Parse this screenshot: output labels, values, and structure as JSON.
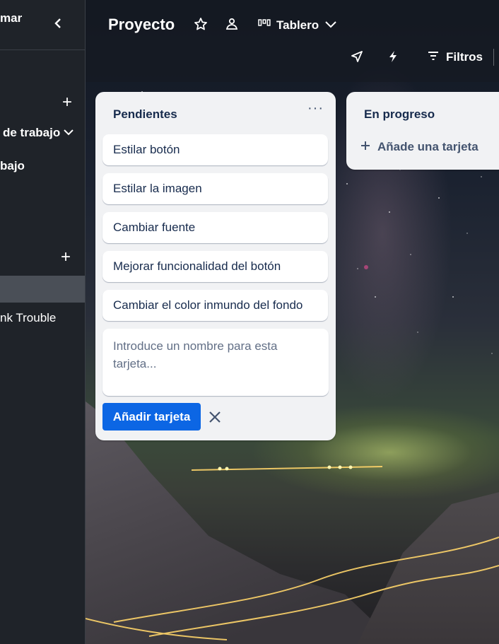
{
  "sidebar": {
    "top_text": "mar",
    "items": [
      {
        "label": "de trabajo"
      },
      {
        "label": "bajo"
      },
      {
        "label": "nk Trouble"
      }
    ]
  },
  "header": {
    "board_title": "Proyecto",
    "view_label": "Tablero",
    "filters_label": "Filtros"
  },
  "lists": [
    {
      "title": "Pendientes",
      "cards": [
        {
          "label": "Estilar botón"
        },
        {
          "label": "Estilar la imagen"
        },
        {
          "label": "Cambiar fuente"
        },
        {
          "label": "Mejorar funcionalidad del botón"
        },
        {
          "label": "Cambiar el color inmundo del fondo"
        }
      ],
      "composer": {
        "placeholder": "Introduce un nombre para esta tarjeta...",
        "submit_label": "Añadir tarjeta"
      }
    },
    {
      "title": "En progreso",
      "add_card_label": "Añade una tarjeta"
    }
  ],
  "colors": {
    "accent": "#0c66e4",
    "list_bg": "#f1f2f4",
    "sidebar_bg": "#1f2329"
  }
}
